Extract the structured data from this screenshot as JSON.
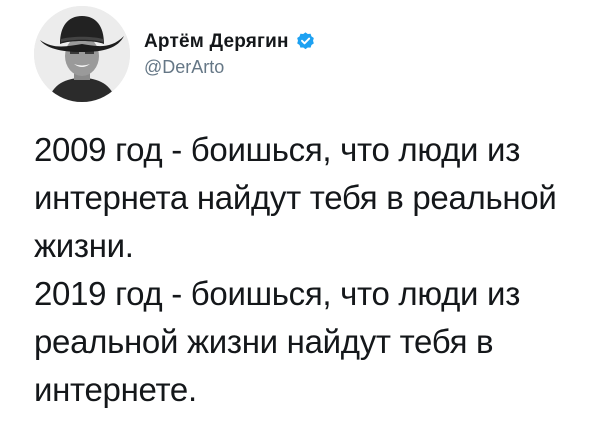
{
  "author": {
    "display_name": "Артём Дерягин",
    "handle": "@DerArto",
    "verified": true,
    "avatar_icon": "profile-photo-cowboy-hat",
    "verified_color": "#1da1f2"
  },
  "tweet": {
    "lines": [
      "2009 год - боишься, что люди из",
      "интернета найдут тебя в реальной",
      "жизни.",
      "2019 год - боишься, что люди из",
      "реальной жизни найдут тебя в",
      "интернете."
    ]
  }
}
